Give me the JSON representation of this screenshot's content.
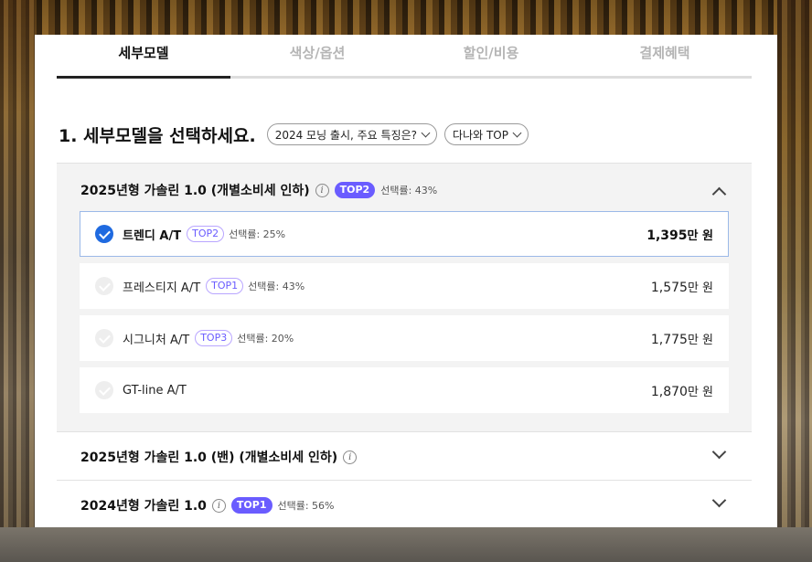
{
  "tabs": [
    {
      "label": "세부모델",
      "active": true
    },
    {
      "label": "색상/옵션",
      "active": false
    },
    {
      "label": "할인/비용",
      "active": false
    },
    {
      "label": "결제혜택",
      "active": false
    }
  ],
  "step": {
    "title": "1. 세부모델을 선택하세요.",
    "chip1": "2024 모닝 출시, 주요 특징은?",
    "chip2": "다나와 TOP"
  },
  "groups": [
    {
      "title": "2025년형 가솔린 1.0 (개별소비세 인하)",
      "badge": "TOP2",
      "rate": "선택률: 43%",
      "expanded": true,
      "options": [
        {
          "name": "트렌디 A/T",
          "badge": "TOP2",
          "rate": "선택률: 25%",
          "price": "1,395",
          "unit": "만 원",
          "selected": true
        },
        {
          "name": "프레스티지 A/T",
          "badge": "TOP1",
          "rate": "선택률: 43%",
          "price": "1,575",
          "unit": "만 원",
          "selected": false
        },
        {
          "name": "시그니처 A/T",
          "badge": "TOP3",
          "rate": "선택률: 20%",
          "price": "1,775",
          "unit": "만 원",
          "selected": false
        },
        {
          "name": "GT-line A/T",
          "badge": "",
          "rate": "",
          "price": "1,870",
          "unit": "만 원",
          "selected": false
        }
      ]
    },
    {
      "title": "2025년형 가솔린 1.0 (밴) (개별소비세 인하)",
      "badge": "",
      "rate": "",
      "expanded": false
    },
    {
      "title": "2024년형 가솔린 1.0",
      "badge": "TOP1",
      "rate": "선택률: 56%",
      "expanded": false
    }
  ],
  "icons": {
    "info": "info-icon",
    "check": "check-circle-icon",
    "expand": "chevron-down-icon",
    "collapse": "chevron-up-icon"
  },
  "colors": {
    "accent": "#1f6ae0",
    "badge": "#6a5cff"
  }
}
